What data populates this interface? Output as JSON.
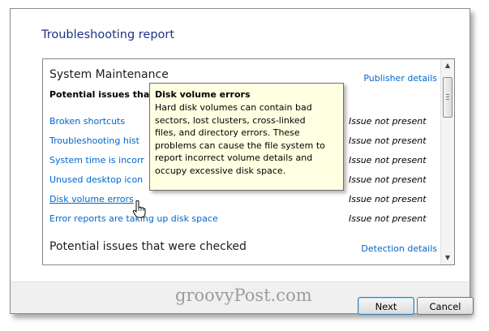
{
  "window_title": "Troubleshooting report",
  "system_section": {
    "title": "System Maintenance",
    "link": "Publisher details",
    "subheading": "Potential issues that",
    "rows": [
      {
        "label": "Broken shortcuts",
        "status": "Issue not present"
      },
      {
        "label": "Troubleshooting hist",
        "status": "Issue not present"
      },
      {
        "label": "System time is incorr",
        "status": "Issue not present"
      },
      {
        "label": "Unused desktop icon",
        "status": "Issue not present"
      },
      {
        "label": "Disk volume errors",
        "status": "Issue not present"
      },
      {
        "label": "Error reports are taking up disk space",
        "status": "Issue not present"
      }
    ]
  },
  "checked_section": {
    "title": "Potential issues that were checked",
    "link": "Detection details"
  },
  "tooltip": {
    "title": "Disk volume errors",
    "lines": [
      "Hard disk volumes can contain bad",
      "sectors, lost clusters, cross-linked",
      "files, and directory errors. These",
      "problems can cause the file system to",
      "report incorrect volume details and",
      "occupy excessive disk space."
    ]
  },
  "buttons": {
    "next": "Next",
    "cancel": "Cancel"
  },
  "watermark": "groovyPost.com",
  "colors": {
    "link": "#0066cc",
    "title": "#1e3287",
    "tooltip_bg": "#ffffe1"
  }
}
